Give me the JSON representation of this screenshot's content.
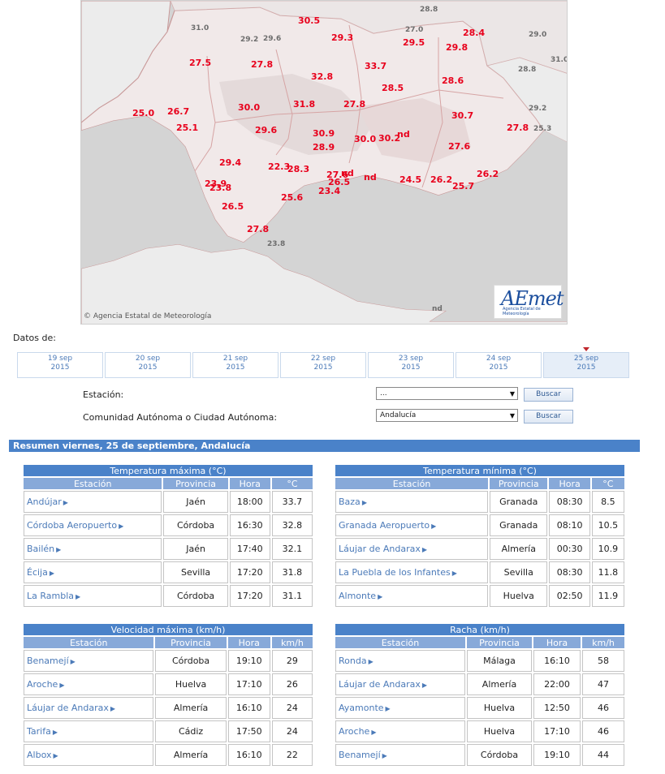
{
  "map": {
    "credit": "© Agencia Estatal de Meteorología",
    "logo": {
      "name": "AEmet",
      "subtitle": "Agencia Estatal de Meteorología"
    },
    "values": [
      {
        "v": "28.8",
        "g": true
      },
      {
        "v": "31.0",
        "g": true
      },
      {
        "v": "29.2",
        "g": true
      },
      {
        "v": "29.6",
        "g": true
      },
      {
        "v": "30.5",
        "g": false
      },
      {
        "v": "29.3",
        "g": false
      },
      {
        "v": "27.0",
        "g": true
      },
      {
        "v": "29.5",
        "g": false
      },
      {
        "v": "28.4",
        "g": false
      },
      {
        "v": "29.8",
        "g": false
      },
      {
        "v": "29.0",
        "g": true
      },
      {
        "v": "31.0",
        "g": true
      },
      {
        "v": "28.8",
        "g": true
      },
      {
        "v": "27.5",
        "g": false
      },
      {
        "v": "27.8",
        "g": false
      },
      {
        "v": "33.7",
        "g": false
      },
      {
        "v": "32.8",
        "g": false
      },
      {
        "v": "28.5",
        "g": false
      },
      {
        "v": "28.6",
        "g": false
      },
      {
        "v": "30.0",
        "g": false
      },
      {
        "v": "31.8",
        "g": false
      },
      {
        "v": "27.8",
        "g": false
      },
      {
        "v": "25.0",
        "g": false
      },
      {
        "v": "26.7",
        "g": false
      },
      {
        "v": "30.7",
        "g": false
      },
      {
        "v": "29.2",
        "g": true
      },
      {
        "v": "25.1",
        "g": false
      },
      {
        "v": "29.6",
        "g": false
      },
      {
        "v": "30.9",
        "g": false
      },
      {
        "v": "30.0",
        "g": false
      },
      {
        "v": "30.2",
        "g": false
      },
      {
        "v": "nd",
        "g": false
      },
      {
        "v": "27.8",
        "g": false
      },
      {
        "v": "25.3",
        "g": true
      },
      {
        "v": "28.9",
        "g": false
      },
      {
        "v": "27.6",
        "g": false
      },
      {
        "v": "29.4",
        "g": false
      },
      {
        "v": "22.3",
        "g": false
      },
      {
        "v": "28.3",
        "g": false
      },
      {
        "v": "27.6",
        "g": false
      },
      {
        "v": "nd",
        "g": false
      },
      {
        "v": "nd",
        "g": false
      },
      {
        "v": "24.5",
        "g": false
      },
      {
        "v": "26.2",
        "g": false
      },
      {
        "v": "26.2",
        "g": false
      },
      {
        "v": "23.9",
        "g": false
      },
      {
        "v": "26.5",
        "g": false
      },
      {
        "v": "25.7",
        "g": false
      },
      {
        "v": "23.8",
        "g": false
      },
      {
        "v": "23.4",
        "g": false
      },
      {
        "v": "25.6",
        "g": false
      },
      {
        "v": "26.5",
        "g": false
      },
      {
        "v": "27.8",
        "g": false
      },
      {
        "v": "23.8",
        "g": true
      },
      {
        "v": "nd",
        "g": true
      }
    ]
  },
  "datos_label": "Datos de:",
  "days": [
    {
      "date": "19 sep",
      "year": "2015"
    },
    {
      "date": "20 sep",
      "year": "2015"
    },
    {
      "date": "21 sep",
      "year": "2015"
    },
    {
      "date": "22 sep",
      "year": "2015"
    },
    {
      "date": "23 sep",
      "year": "2015"
    },
    {
      "date": "24 sep",
      "year": "2015"
    },
    {
      "date": "25 sep",
      "year": "2015"
    }
  ],
  "form": {
    "station_label": "Estación:",
    "station_value": "...",
    "region_label": "Comunidad Autónoma o Ciudad Autónoma:",
    "region_value": "Andalucía",
    "search_label": "Buscar"
  },
  "resumen": "Resumen viernes, 25 de septiembre, Andalucía",
  "tables": {
    "tmax": {
      "caption": "Temperatura máxima (°C)",
      "headers": [
        "Estación",
        "Provincia",
        "Hora",
        "°C"
      ],
      "rows": [
        [
          "Andújar",
          "Jaén",
          "18:00",
          "33.7"
        ],
        [
          "Córdoba Aeropuerto",
          "Córdoba",
          "16:30",
          "32.8"
        ],
        [
          "Bailén",
          "Jaén",
          "17:40",
          "32.1"
        ],
        [
          "Écija",
          "Sevilla",
          "17:20",
          "31.8"
        ],
        [
          "La Rambla",
          "Córdoba",
          "17:20",
          "31.1"
        ]
      ]
    },
    "tmin": {
      "caption": "Temperatura mínima (°C)",
      "headers": [
        "Estación",
        "Provincia",
        "Hora",
        "°C"
      ],
      "rows": [
        [
          "Baza",
          "Granada",
          "08:30",
          "8.5"
        ],
        [
          "Granada Aeropuerto",
          "Granada",
          "08:10",
          "10.5"
        ],
        [
          "Láujar de Andarax",
          "Almería",
          "00:30",
          "10.9"
        ],
        [
          "La Puebla de los Infantes",
          "Sevilla",
          "08:30",
          "11.8"
        ],
        [
          "Almonte",
          "Huelva",
          "02:50",
          "11.9"
        ]
      ]
    },
    "vmax": {
      "caption": "Velocidad máxima (km/h)",
      "headers": [
        "Estación",
        "Provincia",
        "Hora",
        "km/h"
      ],
      "rows": [
        [
          "Benamejí",
          "Córdoba",
          "19:10",
          "29"
        ],
        [
          "Aroche",
          "Huelva",
          "17:10",
          "26"
        ],
        [
          "Láujar de Andarax",
          "Almería",
          "16:10",
          "24"
        ],
        [
          "Tarifa",
          "Cádiz",
          "17:50",
          "24"
        ],
        [
          "Albox",
          "Almería",
          "16:10",
          "22"
        ]
      ]
    },
    "racha": {
      "caption": "Racha (km/h)",
      "headers": [
        "Estación",
        "Provincia",
        "Hora",
        "km/h"
      ],
      "rows": [
        [
          "Ronda",
          "Málaga",
          "16:10",
          "58"
        ],
        [
          "Láujar de Andarax",
          "Almería",
          "22:00",
          "47"
        ],
        [
          "Ayamonte",
          "Huelva",
          "12:50",
          "46"
        ],
        [
          "Aroche",
          "Huelva",
          "17:10",
          "46"
        ],
        [
          "Benamejí",
          "Córdoba",
          "19:10",
          "44"
        ]
      ]
    }
  }
}
